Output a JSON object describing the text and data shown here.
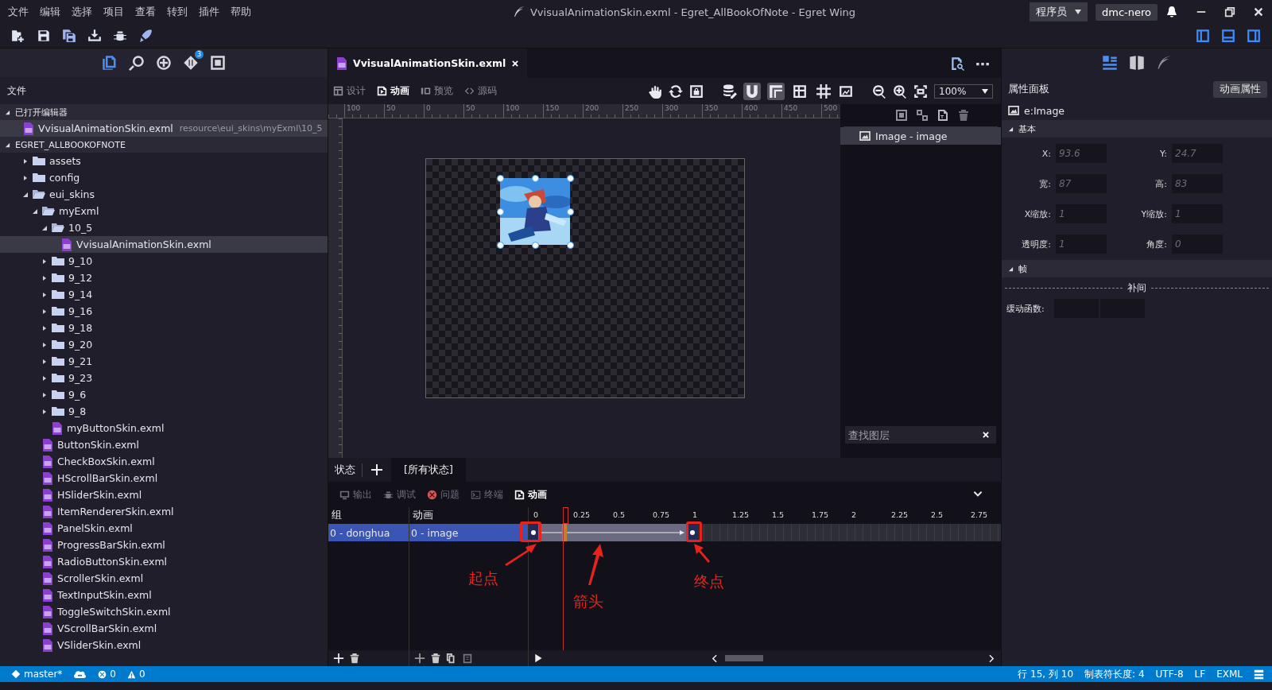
{
  "menu": [
    "文件",
    "编辑",
    "选择",
    "项目",
    "查看",
    "转到",
    "插件",
    "帮助"
  ],
  "window": {
    "title": "VvisualAnimationSkin.exml - Egret_AllBookOfNote - Egret Wing"
  },
  "account": {
    "role": "程序员",
    "user": "dmc-nero"
  },
  "sidebar": {
    "badge": "3",
    "title": "文件",
    "sections": [
      {
        "label": "已打开编辑器",
        "expanded": true,
        "children": [
          {
            "kind": "file",
            "label": "VvisualAnimationSkin.exml",
            "path": "resource\\eui_skins\\myExml\\10_5",
            "selected": true
          }
        ]
      },
      {
        "label": "EGRET_ALLBOOKOFNOTE",
        "expanded": true,
        "children": [
          {
            "kind": "folder",
            "label": "assets",
            "expanded": false,
            "selected": false
          },
          {
            "kind": "folder",
            "label": "config",
            "expanded": false,
            "selected": false
          },
          {
            "kind": "folder",
            "label": "eui_skins",
            "expanded": true,
            "selected": false,
            "children": [
              {
                "kind": "folder",
                "label": "myExml",
                "expanded": true,
                "selected": false,
                "children": [
                  {
                    "kind": "folder",
                    "label": "10_5",
                    "expanded": true,
                    "selected": false,
                    "children": [
                      {
                        "kind": "file",
                        "label": "VvisualAnimationSkin.exml",
                        "selected": true
                      }
                    ]
                  },
                  {
                    "kind": "folder",
                    "label": "9_10",
                    "expanded": false,
                    "selected": false
                  },
                  {
                    "kind": "folder",
                    "label": "9_12",
                    "expanded": false,
                    "selected": false
                  },
                  {
                    "kind": "folder",
                    "label": "9_14",
                    "expanded": false,
                    "selected": false
                  },
                  {
                    "kind": "folder",
                    "label": "9_16",
                    "expanded": false,
                    "selected": false
                  },
                  {
                    "kind": "folder",
                    "label": "9_18",
                    "expanded": false,
                    "selected": false
                  },
                  {
                    "kind": "folder",
                    "label": "9_20",
                    "expanded": false,
                    "selected": false
                  },
                  {
                    "kind": "folder",
                    "label": "9_21",
                    "expanded": false,
                    "selected": false
                  },
                  {
                    "kind": "folder",
                    "label": "9_23",
                    "expanded": false,
                    "selected": false
                  },
                  {
                    "kind": "folder",
                    "label": "9_6",
                    "expanded": false,
                    "selected": false
                  },
                  {
                    "kind": "folder",
                    "label": "9_8",
                    "expanded": false,
                    "selected": false
                  },
                  {
                    "kind": "file",
                    "label": "myButtonSkin.exml",
                    "selected": false
                  }
                ]
              },
              {
                "kind": "file",
                "label": "ButtonSkin.exml",
                "selected": false
              },
              {
                "kind": "file",
                "label": "CheckBoxSkin.exml",
                "selected": false
              },
              {
                "kind": "file",
                "label": "HScrollBarSkin.exml",
                "selected": false
              },
              {
                "kind": "file",
                "label": "HSliderSkin.exml",
                "selected": false
              },
              {
                "kind": "file",
                "label": "ItemRendererSkin.exml",
                "selected": false
              },
              {
                "kind": "file",
                "label": "PanelSkin.exml",
                "selected": false
              },
              {
                "kind": "file",
                "label": "ProgressBarSkin.exml",
                "selected": false
              },
              {
                "kind": "file",
                "label": "RadioButtonSkin.exml",
                "selected": false
              },
              {
                "kind": "file",
                "label": "ScrollerSkin.exml",
                "selected": false
              },
              {
                "kind": "file",
                "label": "TextInputSkin.exml",
                "selected": false
              },
              {
                "kind": "file",
                "label": "ToggleSwitchSkin.exml",
                "selected": false
              },
              {
                "kind": "file",
                "label": "VScrollBarSkin.exml",
                "selected": false
              },
              {
                "kind": "file",
                "label": "VSliderSkin.exml",
                "selected": false
              }
            ]
          }
        ]
      }
    ]
  },
  "editor_tabs": [
    {
      "label": "VvisualAnimationSkin.exml",
      "selected": true
    }
  ],
  "modes": [
    {
      "label": "设计",
      "selected": false
    },
    {
      "label": "动画",
      "selected": true
    },
    {
      "label": "预览",
      "selected": false
    },
    {
      "label": "源码",
      "selected": false
    }
  ],
  "toggles": [
    {
      "kind": "magnet",
      "on": true
    },
    {
      "kind": "snap",
      "on": true
    },
    {
      "kind": "grid",
      "on": false
    },
    {
      "kind": "guides",
      "on": false
    }
  ],
  "zoom": "100%",
  "ruler_labels": [
    "100",
    "50",
    "0",
    "50",
    "100",
    "150",
    "200",
    "250",
    "300",
    "350",
    "400",
    "450",
    "500"
  ],
  "layers": {
    "items": [
      {
        "label": "Image - image",
        "selected": true
      }
    ],
    "search": {
      "placeholder": "查找图层"
    }
  },
  "properties": {
    "title": "属性面板",
    "button": "动画属性",
    "target": "e:Image",
    "sections": [
      {
        "label": "基本",
        "expanded": true
      },
      {
        "label": "帧",
        "expanded": true
      }
    ],
    "fields": [
      {
        "label": "X:",
        "value": "93.6"
      },
      {
        "label": "Y:",
        "value": "24.7"
      },
      {
        "label": "宽:",
        "value": "87"
      },
      {
        "label": "高:",
        "value": "83"
      },
      {
        "label": "X缩放:",
        "value": "1"
      },
      {
        "label": "Y缩放:",
        "value": "1"
      },
      {
        "label": "透明度:",
        "value": "1"
      },
      {
        "label": "角度:",
        "value": "0"
      }
    ],
    "tween_label": "补间",
    "easing_label": "缓动函数:"
  },
  "states": {
    "label": "状态",
    "tabs": [
      {
        "label": "[所有状态]",
        "selected": true
      }
    ]
  },
  "panel_tabs": [
    {
      "kind": "output",
      "label": "输出",
      "selected": false
    },
    {
      "kind": "debug",
      "label": "调试",
      "selected": false
    },
    {
      "kind": "problems",
      "label": "问题",
      "selected": false
    },
    {
      "kind": "terminal",
      "label": "终端",
      "selected": false
    },
    {
      "kind": "animation",
      "label": "动画",
      "selected": true
    }
  ],
  "timeline": {
    "columns": [
      "组",
      "动画"
    ],
    "ticks": [
      "0",
      "0.25",
      "0.5",
      "0.75",
      "1",
      "1.25",
      "1.5",
      "1.75",
      "2",
      "2.25",
      "2.5",
      "2.75"
    ],
    "rows": [
      {
        "group": "0 - donghua",
        "animation": "0 - image",
        "selected": true
      }
    ],
    "annotations": [
      {
        "label": "起点"
      },
      {
        "label": "箭头"
      },
      {
        "label": "终点"
      }
    ]
  },
  "status_bar": {
    "branch": "master*",
    "errors": "0",
    "warnings": "0",
    "position": "行 15, 列 10",
    "tab_size": "制表符长度: 4",
    "encoding": "UTF-8",
    "eol": "LF",
    "language": "EXML"
  }
}
